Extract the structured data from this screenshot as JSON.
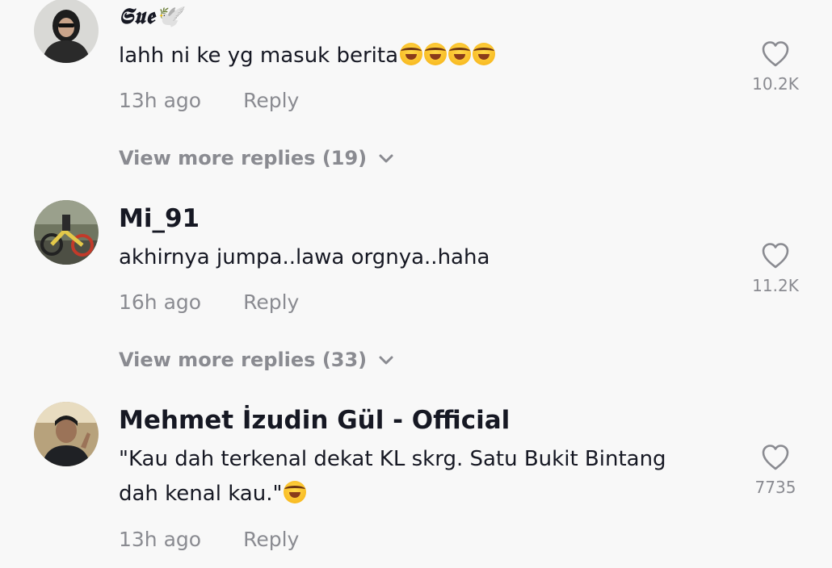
{
  "comments": [
    {
      "username": "𝕾𝖚𝖊🕊️",
      "text": "lahh ni ke yg masuk berita",
      "emoji_count": 4,
      "time": "13h ago",
      "reply": "Reply",
      "likes": "10.2K",
      "view_more": "View more replies (19)"
    },
    {
      "username": "Mi_91",
      "text": "akhirnya jumpa..lawa orgnya..haha",
      "time": "16h ago",
      "reply": "Reply",
      "likes": "11.2K",
      "view_more": "View more replies (33)"
    },
    {
      "username": "Mehmet İzudin Gül - Official",
      "text_line1": "\"Kau dah terkenal dekat KL skrg. Satu Bukit Bintang",
      "text_line2": "dah kenal kau.\"",
      "time": "13h ago",
      "reply": "Reply",
      "likes": "7735"
    }
  ],
  "colors": {
    "background": "#f8f8f8",
    "primary_text": "#161823",
    "secondary_text": "#8a8b91"
  },
  "icons": {
    "like": "heart-outline-icon",
    "expand": "chevron-down-icon",
    "emoji": "face-with-tears-of-joy"
  }
}
